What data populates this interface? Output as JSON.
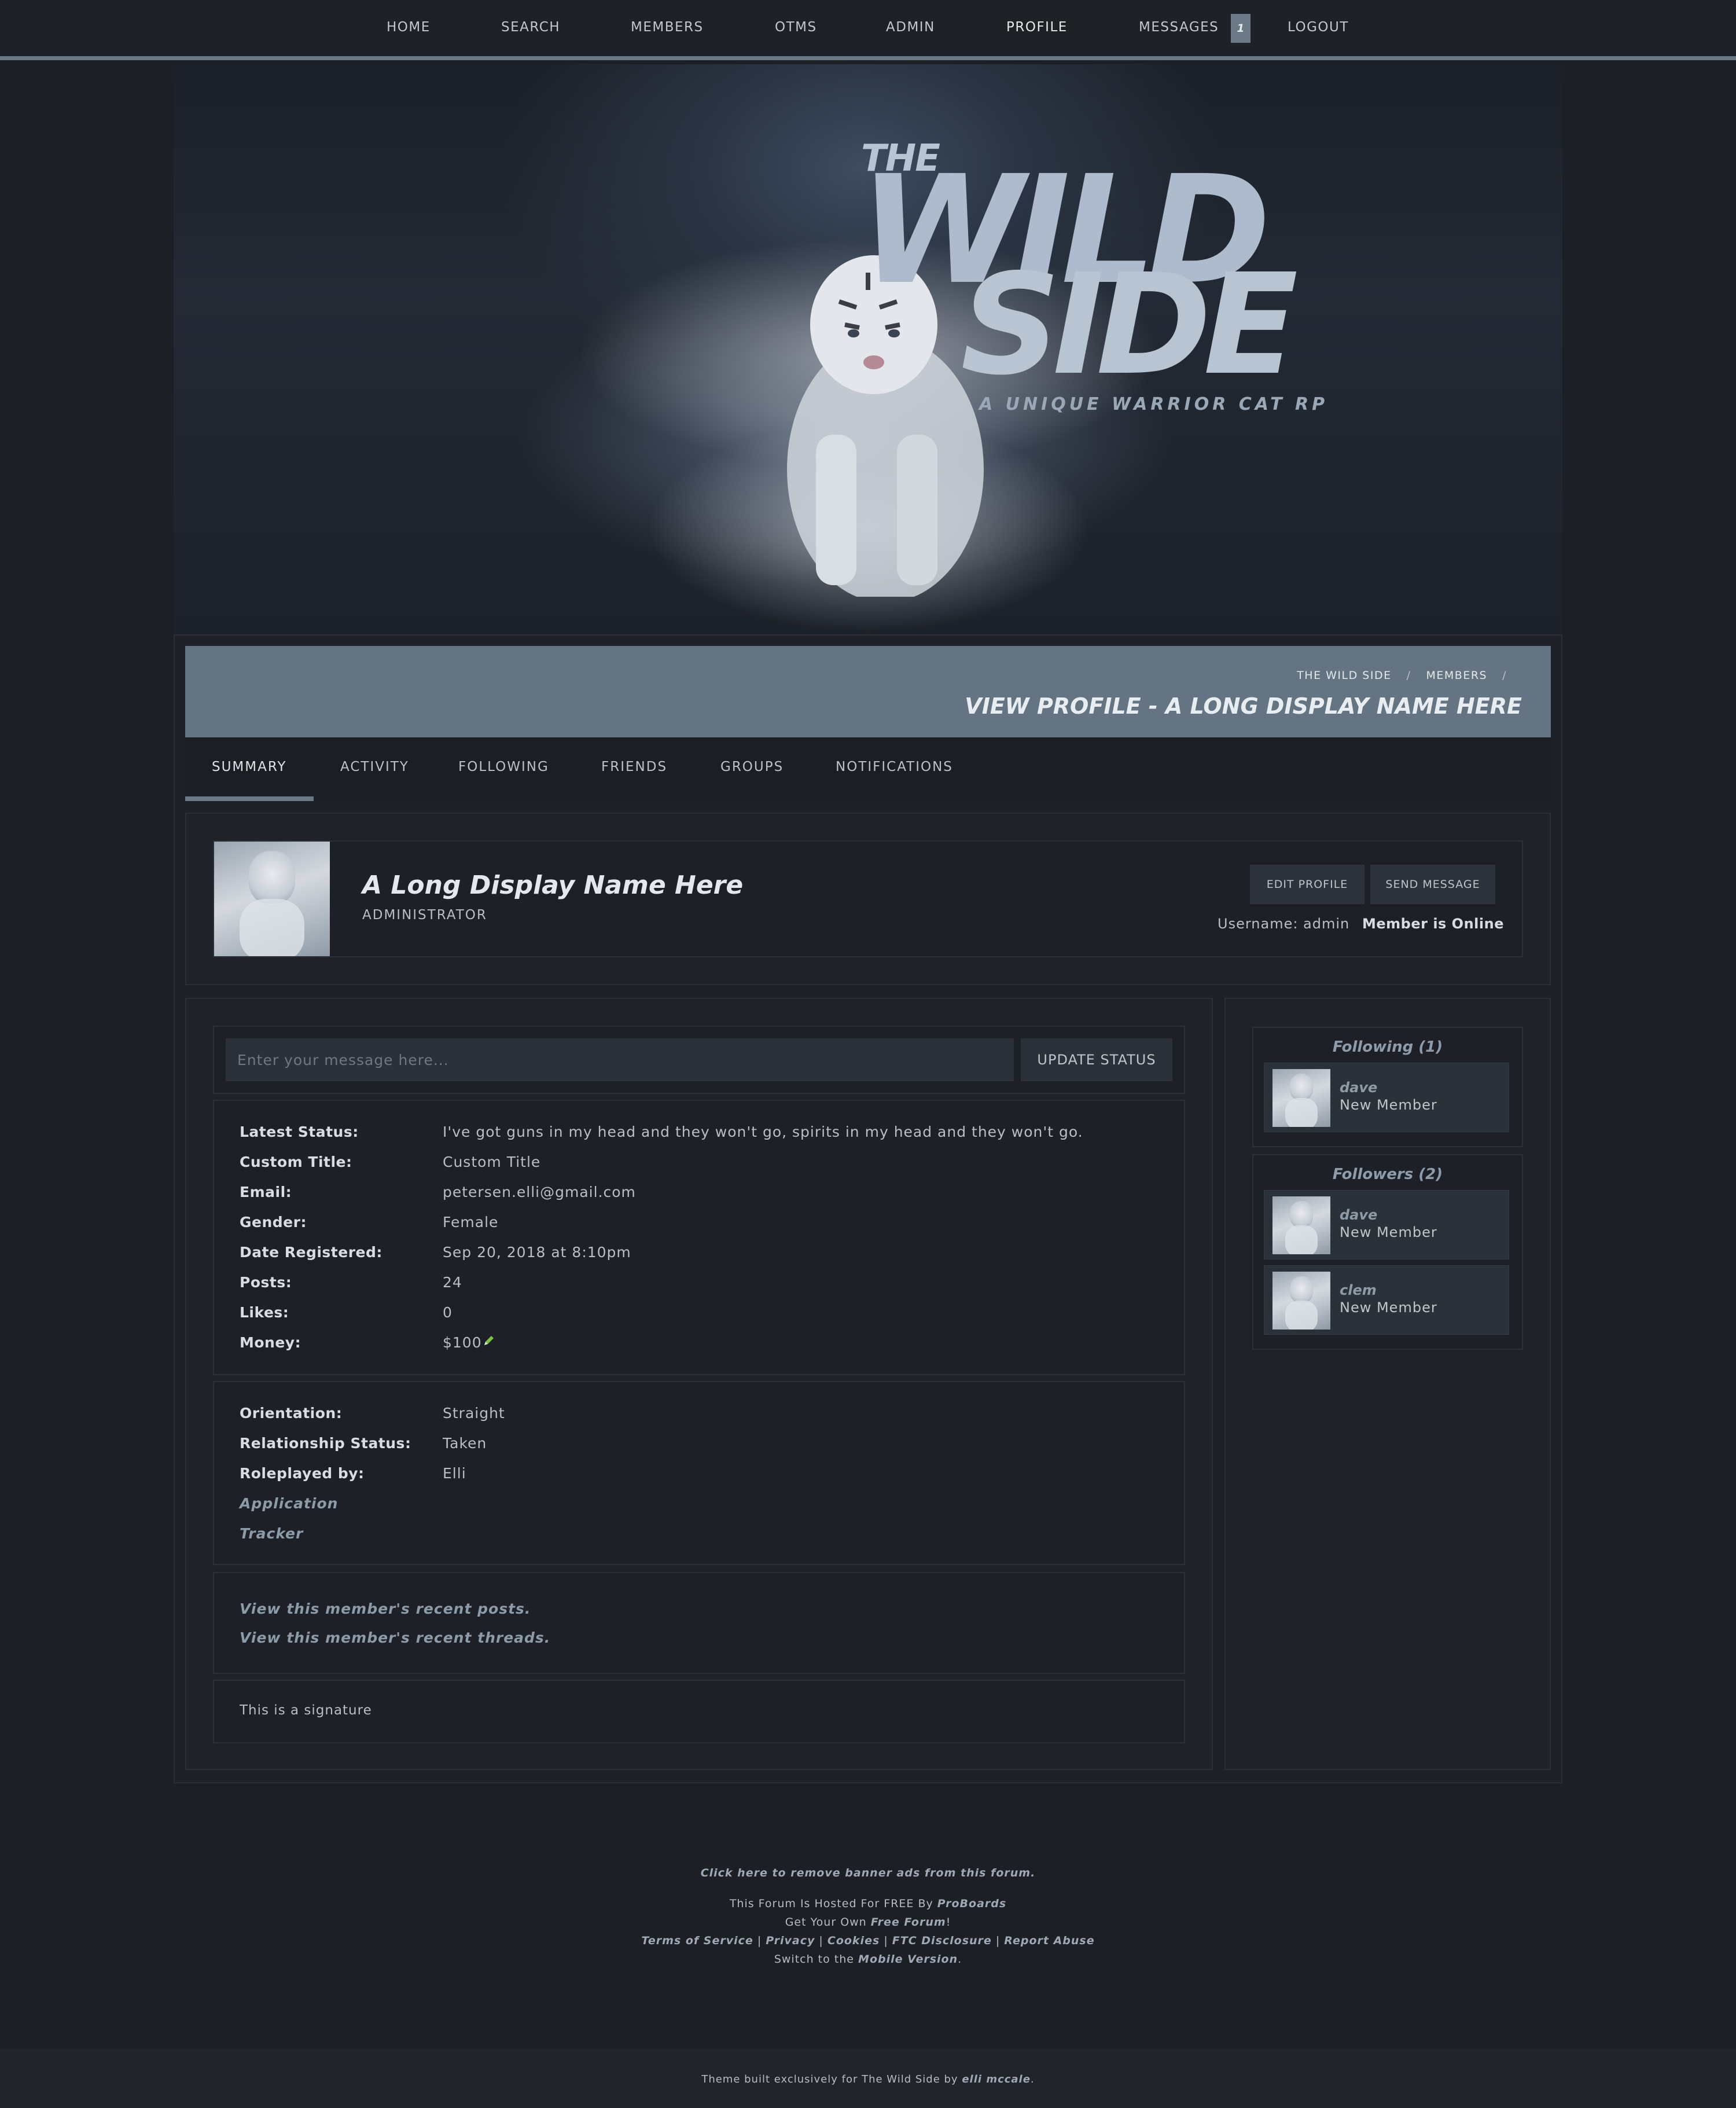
{
  "nav": {
    "items": [
      "HOME",
      "SEARCH",
      "MEMBERS",
      "OTMS",
      "ADMIN",
      "PROFILE",
      "MESSAGES",
      "LOGOUT"
    ],
    "message_count": "1"
  },
  "banner": {
    "the": "THE",
    "wild": "WILD",
    "side": "SIDE",
    "tagline": "A UNIQUE WARRIOR CAT RP"
  },
  "header": {
    "crumbs": [
      "THE WILD SIDE",
      "MEMBERS"
    ],
    "crumb_sep": "/",
    "title": "VIEW PROFILE - A LONG DISPLAY NAME HERE"
  },
  "tabs": [
    "SUMMARY",
    "ACTIVITY",
    "FOLLOWING",
    "FRIENDS",
    "GROUPS",
    "NOTIFICATIONS"
  ],
  "profile": {
    "display_name": "A Long Display Name Here",
    "rank": "ADMINISTRATOR",
    "edit_button": "EDIT PROFILE",
    "message_button": "SEND MESSAGE",
    "username_label": "Username: admin",
    "online": "Member is Online"
  },
  "status": {
    "placeholder": "Enter your message here...",
    "button": "UPDATE STATUS"
  },
  "info": [
    {
      "label": "Latest Status:",
      "value": "I've got guns in my head and they won't go, spirits in my head and they won't go."
    },
    {
      "label": "Custom Title:",
      "value": "Custom Title"
    },
    {
      "label": "Email:",
      "value": "petersen.elli@gmail.com"
    },
    {
      "label": "Gender:",
      "value": "Female"
    },
    {
      "label": "Date Registered:",
      "value": "Sep 20, 2018 at 8:10pm"
    },
    {
      "label": "Posts:",
      "value": "24"
    },
    {
      "label": "Likes:",
      "value": "0"
    },
    {
      "label": "Money:",
      "value": "$100"
    }
  ],
  "fields": [
    {
      "label": "Orientation:",
      "value": "Straight"
    },
    {
      "label": "Relationship Status:",
      "value": "Taken"
    },
    {
      "label": "Roleplayed by:",
      "value": "Elli"
    }
  ],
  "field_links": [
    "Application",
    "Tracker"
  ],
  "recent": [
    "View this member's recent posts.",
    "View this member's recent threads."
  ],
  "signature": "This is a signature",
  "following": {
    "title": "Following (1)",
    "users": [
      {
        "name": "dave",
        "rank": "New Member"
      }
    ]
  },
  "followers": {
    "title": "Followers (2)",
    "users": [
      {
        "name": "dave",
        "rank": "New Member"
      },
      {
        "name": "clem",
        "rank": "New Member"
      }
    ]
  },
  "footer": {
    "remove_ads": "Click here to remove banner ads from this forum.",
    "hosted_prefix": "This Forum Is Hosted For FREE By",
    "hosted_link": "ProBoards",
    "own_prefix": "Get Your Own",
    "own_link": "Free Forum",
    "own_suffix": "!",
    "legal": [
      "Terms of Service",
      "Privacy",
      "Cookies",
      "FTC Disclosure",
      "Report Abuse"
    ],
    "legal_sep": "|",
    "mobile_prefix": "Switch to the",
    "mobile_link": "Mobile Version",
    "mobile_suffix": ".",
    "credit_prefix": "Theme built exclusively for The Wild Side by",
    "credit_link": "elli mccale",
    "credit_suffix": "."
  },
  "colors": {
    "accent": "#6b7885",
    "header_bg": "#657482",
    "page_bg": "#1c1f24",
    "link": "#8d9aa7",
    "money_icon": "#7cc243"
  },
  "icons": {
    "money_edit": "pencil-icon"
  }
}
